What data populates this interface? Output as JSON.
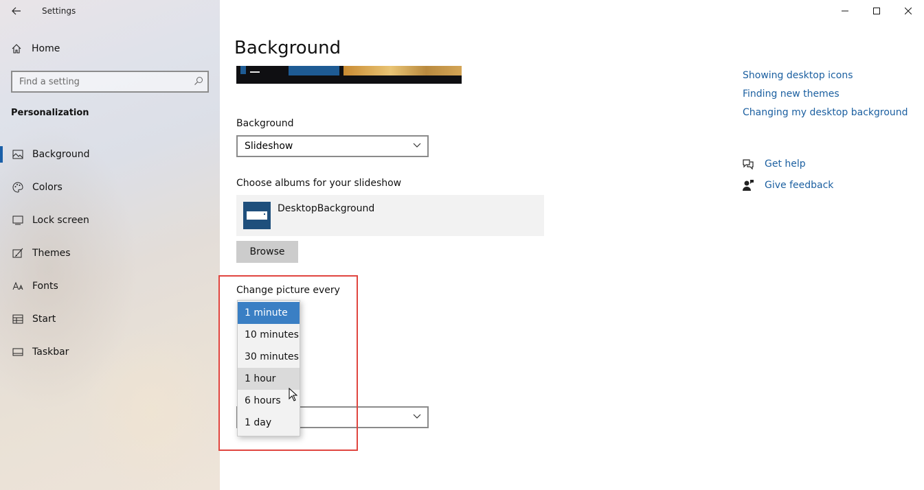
{
  "window": {
    "title": "Settings",
    "controls": [
      "minimize",
      "maximize",
      "close"
    ]
  },
  "sidebar": {
    "home_label": "Home",
    "search_placeholder": "Find a setting",
    "section_title": "Personalization",
    "items": [
      {
        "label": "Background",
        "icon": "picture-icon",
        "active": true
      },
      {
        "label": "Colors",
        "icon": "palette-icon",
        "active": false
      },
      {
        "label": "Lock screen",
        "icon": "lock-screen-icon",
        "active": false
      },
      {
        "label": "Themes",
        "icon": "brush-icon",
        "active": false
      },
      {
        "label": "Fonts",
        "icon": "font-icon",
        "active": false
      },
      {
        "label": "Start",
        "icon": "start-icon",
        "active": false
      },
      {
        "label": "Taskbar",
        "icon": "taskbar-icon",
        "active": false
      }
    ]
  },
  "main": {
    "page_title": "Background",
    "background_label": "Background",
    "background_value": "Slideshow",
    "albums_label": "Choose albums for your slideshow",
    "album_name": "DesktopBackground",
    "browse_label": "Browse",
    "change_label": "Change picture every",
    "change_options": [
      {
        "label": "1 minute",
        "state": "selected"
      },
      {
        "label": "10 minutes",
        "state": "normal"
      },
      {
        "label": "30 minutes",
        "state": "normal"
      },
      {
        "label": "1 hour",
        "state": "hover"
      },
      {
        "label": "6 hours",
        "state": "normal"
      },
      {
        "label": "1 day",
        "state": "normal"
      }
    ]
  },
  "related": {
    "links": [
      "Showing desktop icons",
      "Finding new themes",
      "Changing my desktop background"
    ],
    "get_help": "Get help",
    "give_feedback": "Give feedback"
  },
  "colors": {
    "accent": "#1a5fa8",
    "selected_option": "#3a7fc4",
    "link": "#1b5fa0",
    "highlight_border": "#e0443e"
  }
}
